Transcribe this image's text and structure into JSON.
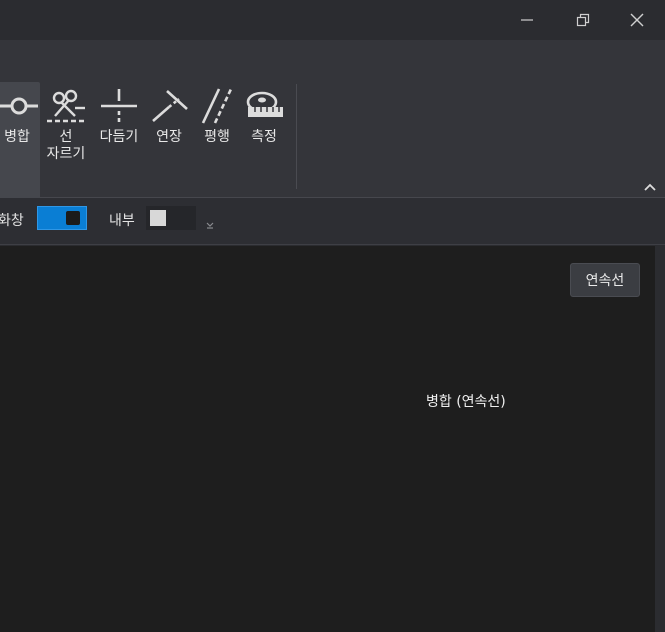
{
  "window": {
    "controls": [
      "minimize-icon",
      "restore-icon",
      "close-icon"
    ]
  },
  "ribbon": {
    "tools": [
      {
        "id": "merge",
        "label": "병합",
        "icon": "merge-icon",
        "active": true
      },
      {
        "id": "cut-line",
        "label": "선\n자르기",
        "icon": "scissors-icon",
        "active": false
      },
      {
        "id": "trim",
        "label": "다듬기",
        "icon": "trim-icon",
        "active": false
      },
      {
        "id": "extend",
        "label": "연장",
        "icon": "extend-icon",
        "active": false
      },
      {
        "id": "parallel",
        "label": "평행",
        "icon": "parallel-icon",
        "active": false
      },
      {
        "id": "measure",
        "label": "측정",
        "icon": "tape-measure-icon",
        "active": false
      }
    ],
    "collapse_icon": "chevron-up-icon"
  },
  "options": {
    "window_label": "화창",
    "window_toggle_on": true,
    "inner_label": "내부",
    "inner_color": "#d8d8d8",
    "accent": "#0a7ed4"
  },
  "canvas": {
    "top_button": "연속선",
    "status_text": "병합 (연속선)",
    "background": "#1e1e1e"
  }
}
